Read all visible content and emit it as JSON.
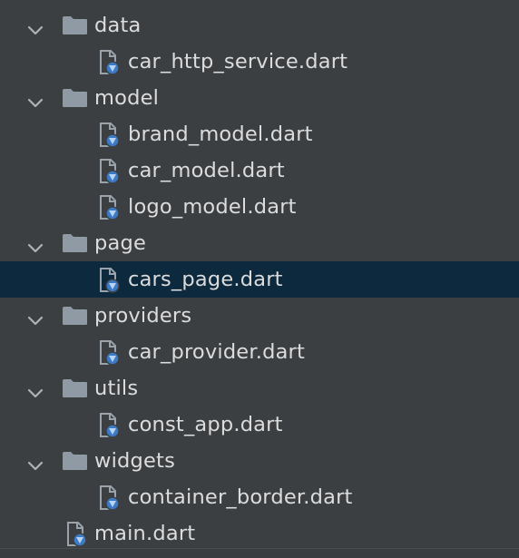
{
  "colors": {
    "background": "#3c3f41",
    "selection": "#0d293e",
    "text": "#dcdcdc",
    "folder_icon": "#8f9aa4",
    "chevron": "#afb1b3",
    "dart_badge": "#3d7ac6"
  },
  "icons": {
    "expanded": "chevron-down-icon",
    "folder": "folder-icon",
    "dart_file": "dart-file-icon"
  },
  "tree": [
    {
      "kind": "folder",
      "label": "data",
      "level": 0,
      "expanded": true
    },
    {
      "kind": "file",
      "label": "car_http_service.dart",
      "level": 1
    },
    {
      "kind": "folder",
      "label": "model",
      "level": 0,
      "expanded": true
    },
    {
      "kind": "file",
      "label": "brand_model.dart",
      "level": 1
    },
    {
      "kind": "file",
      "label": "car_model.dart",
      "level": 1
    },
    {
      "kind": "file",
      "label": "logo_model.dart",
      "level": 1
    },
    {
      "kind": "folder",
      "label": "page",
      "level": 0,
      "expanded": true
    },
    {
      "kind": "file",
      "label": "cars_page.dart",
      "level": 1,
      "selected": true
    },
    {
      "kind": "folder",
      "label": "providers",
      "level": 0,
      "expanded": true
    },
    {
      "kind": "file",
      "label": "car_provider.dart",
      "level": 1
    },
    {
      "kind": "folder",
      "label": "utils",
      "level": 0,
      "expanded": true
    },
    {
      "kind": "file",
      "label": "const_app.dart",
      "level": 1
    },
    {
      "kind": "folder",
      "label": "widgets",
      "level": 0,
      "expanded": true
    },
    {
      "kind": "file",
      "label": "container_border.dart",
      "level": 1
    },
    {
      "kind": "file",
      "label": "main.dart",
      "level": 0
    }
  ]
}
